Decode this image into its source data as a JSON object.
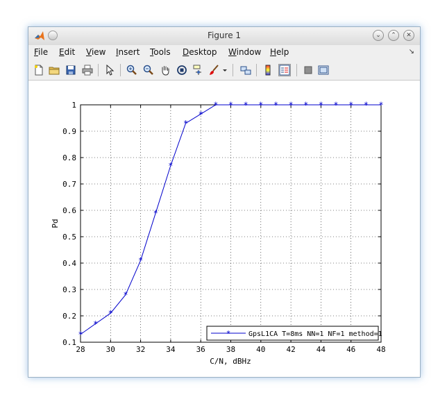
{
  "window": {
    "title": "Figure 1"
  },
  "menu": [
    {
      "label": "File",
      "key": "F",
      "rest": "ile"
    },
    {
      "label": "Edit",
      "key": "E",
      "rest": "dit"
    },
    {
      "label": "View",
      "key": "V",
      "rest": "iew"
    },
    {
      "label": "Insert",
      "key": "I",
      "rest": "nsert"
    },
    {
      "label": "Tools",
      "key": "T",
      "rest": "ools"
    },
    {
      "label": "Desktop",
      "key": "D",
      "rest": "esktop"
    },
    {
      "label": "Window",
      "key": "W",
      "rest": "indow"
    },
    {
      "label": "Help",
      "key": "H",
      "rest": "elp"
    }
  ],
  "toolbar": [
    "new-file-icon",
    "open-folder-icon",
    "save-icon",
    "print-icon",
    "pointer-icon",
    "zoom-in-icon",
    "zoom-out-icon",
    "pan-hand-icon",
    "rotate-3d-icon",
    "data-cursor-icon",
    "brush-icon",
    "link-plot-icon",
    "colorbar-icon",
    "legend-icon",
    "hide-plot-tools-icon",
    "show-plot-tools-icon"
  ],
  "chart_data": {
    "type": "line",
    "xlabel": "C/N, dBHz",
    "ylabel": "Pd",
    "xlim": [
      28,
      48
    ],
    "ylim": [
      0.1,
      1
    ],
    "xticks": [
      28,
      30,
      32,
      34,
      36,
      38,
      40,
      42,
      44,
      46,
      48
    ],
    "yticks": [
      0.1,
      0.2,
      0.3,
      0.4,
      0.5,
      0.6,
      0.7,
      0.8,
      0.9,
      1
    ],
    "ytick_labels": [
      "0.1",
      "0.2",
      "0.3",
      "0.4",
      "0.5",
      "0.6",
      "0.7",
      "0.8",
      "0.9",
      "1"
    ],
    "grid": true,
    "legend_position": "bottom-right",
    "series": [
      {
        "name": "GpsL1CA T=8ms NN=1 NF=1 method=1",
        "color": "#0000cc",
        "marker": "asterisk",
        "x": [
          28,
          29,
          30,
          31,
          32,
          33,
          34,
          35,
          36,
          37,
          38,
          39,
          40,
          41,
          42,
          43,
          44,
          45,
          46,
          47,
          48
        ],
        "y": [
          0.13,
          0.17,
          0.21,
          0.28,
          0.41,
          0.59,
          0.77,
          0.93,
          0.965,
          1,
          1,
          1,
          1,
          1,
          1,
          1,
          1,
          1,
          1,
          1,
          1
        ]
      }
    ]
  }
}
